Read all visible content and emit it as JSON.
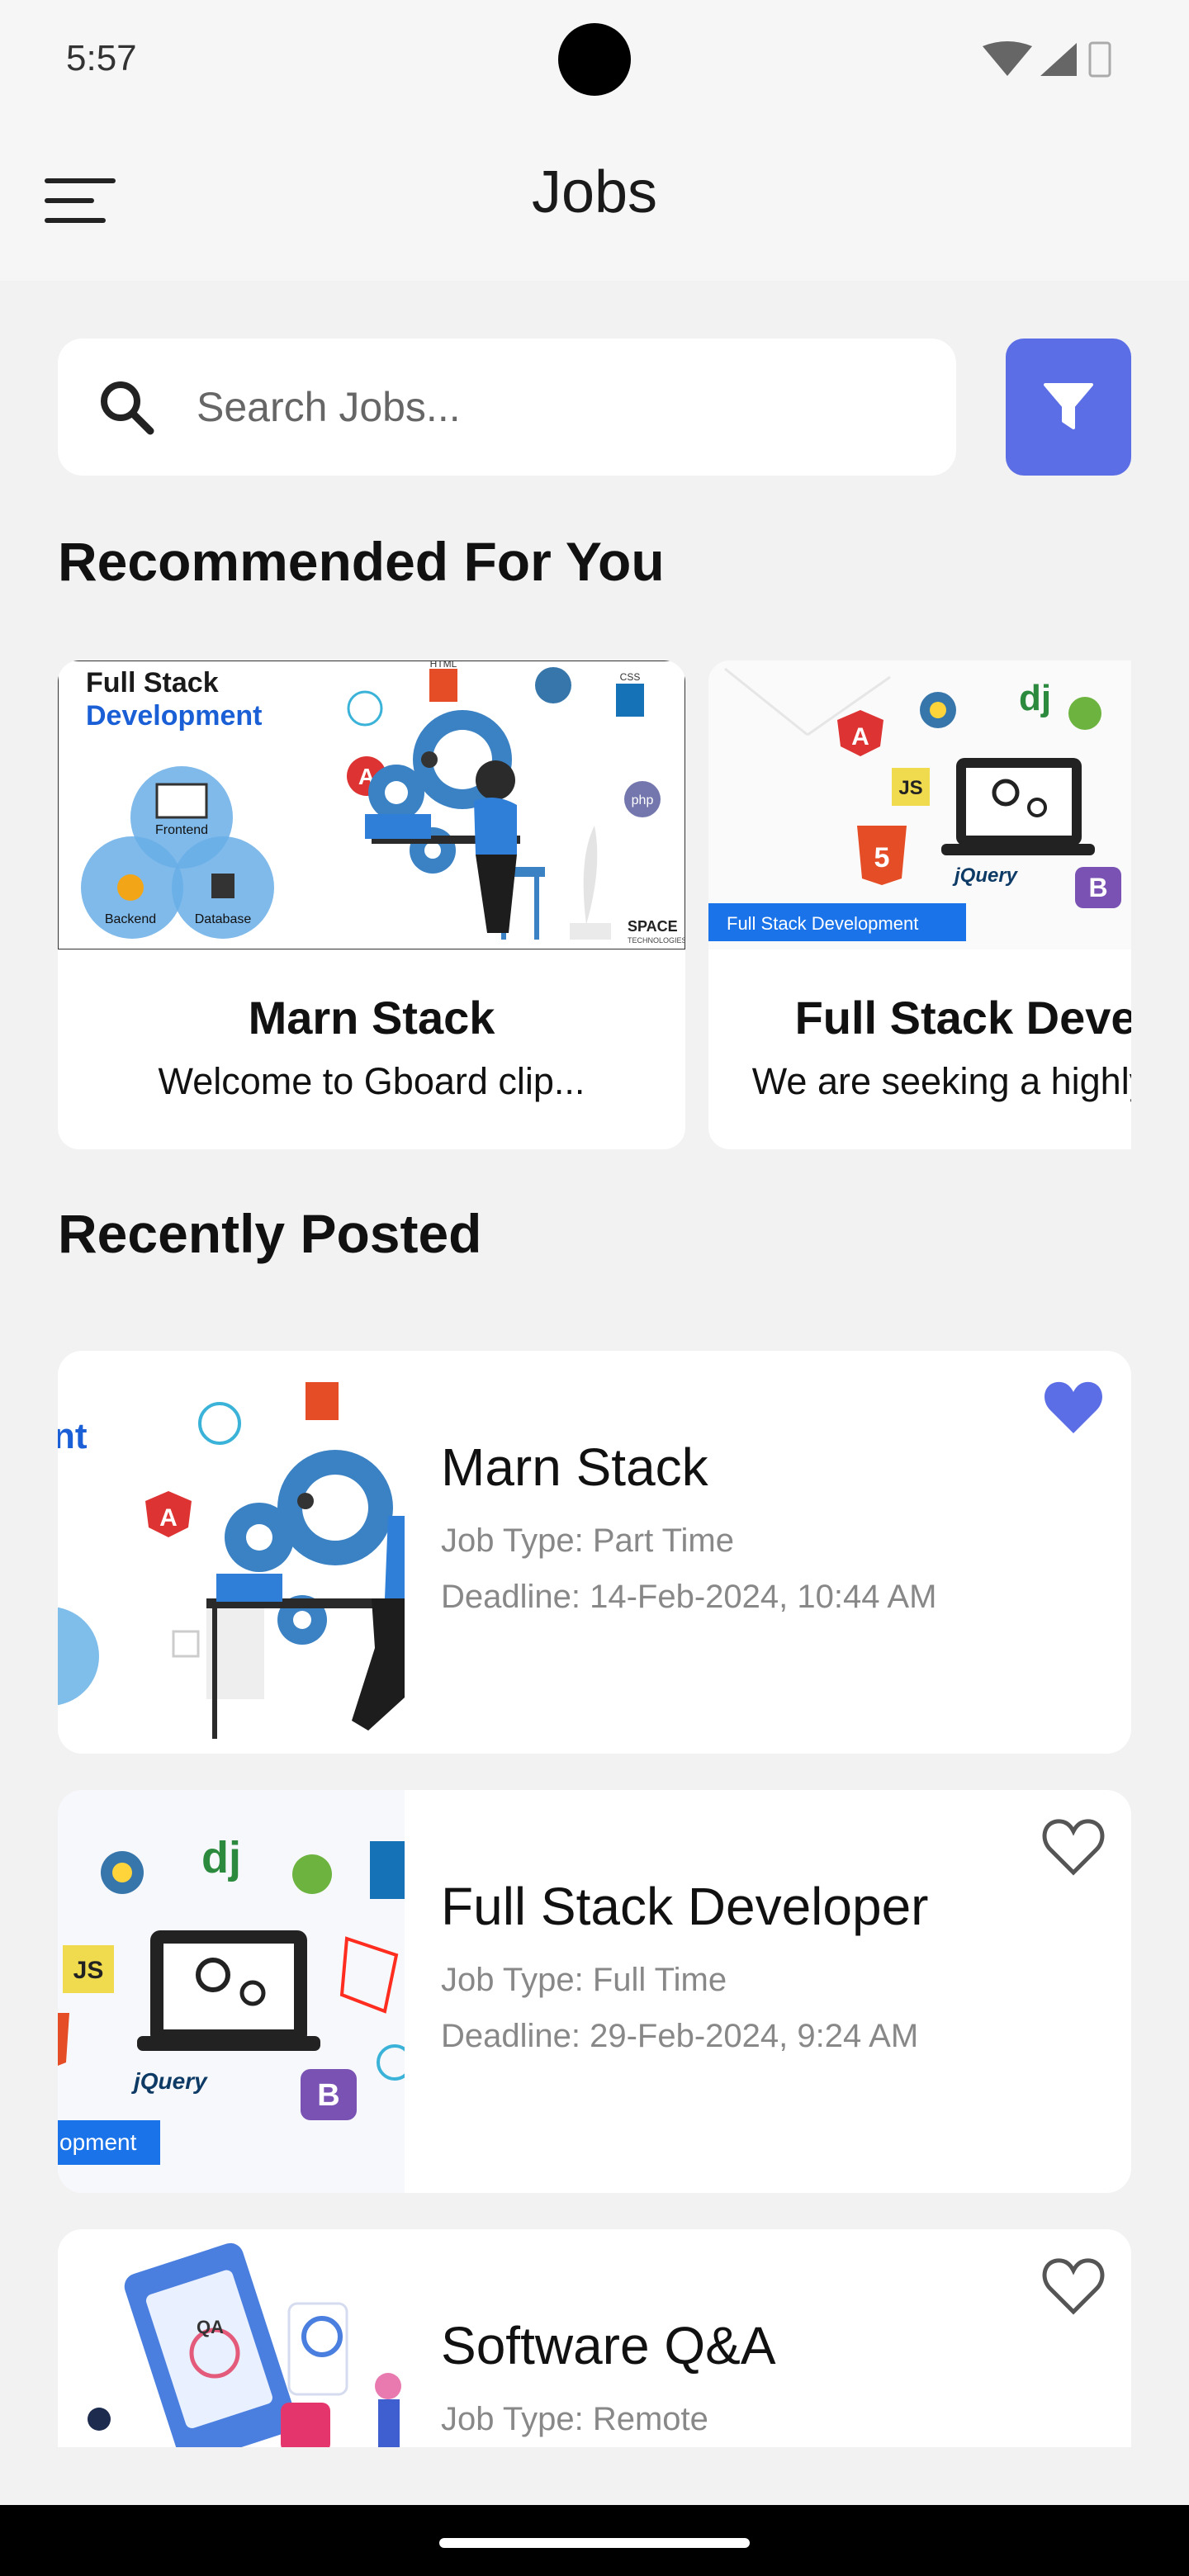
{
  "status_bar": {
    "time": "5:57"
  },
  "app_bar": {
    "title": "Jobs",
    "menu_icon": "hamburger-menu-icon"
  },
  "search": {
    "placeholder": "Search Jobs...",
    "value": "",
    "icon": "search-icon"
  },
  "filter": {
    "icon": "filter-funnel-icon",
    "color": "#5b6ee6"
  },
  "sections": {
    "recommended": "Recommended For You",
    "recent": "Recently Posted"
  },
  "recommended": [
    {
      "title": "Marn Stack",
      "description": "Welcome to Gboard clip...",
      "image": {
        "heading_line1": "Full Stack",
        "heading_line2": "Development",
        "circle_labels": [
          "Frontend",
          "Backend",
          "Database"
        ],
        "badges": [
          "HTML",
          "CSS",
          "php"
        ],
        "brand": "SPACE",
        "brand_sub": "TECHNOLOGIES"
      }
    },
    {
      "title": "Full Stack Developer",
      "description": "We are seeking a highly skilled...",
      "image": {
        "ribbon": "Full Stack Development",
        "badges": [
          "JS",
          "dj",
          "B"
        ],
        "jquery": "jQuery"
      }
    }
  ],
  "recent": [
    {
      "title": "Marn Stack",
      "job_type": "Job Type: Part Time",
      "deadline": "Deadline: 14-Feb-2024, 10:44 AM",
      "favorited": true,
      "image_badge": "nt"
    },
    {
      "title": "Full Stack Developer",
      "job_type": "Job Type: Full Time",
      "deadline": "Deadline: 29-Feb-2024, 9:24 AM",
      "favorited": false,
      "image_badge": "opment"
    },
    {
      "title": "Software Q&A",
      "job_type": "Job Type: Remote",
      "deadline": "",
      "favorited": false,
      "image_badge": "QA"
    }
  ],
  "colors": {
    "accent": "#5b6ee6",
    "background": "#f2f2f2",
    "card": "#ffffff"
  }
}
